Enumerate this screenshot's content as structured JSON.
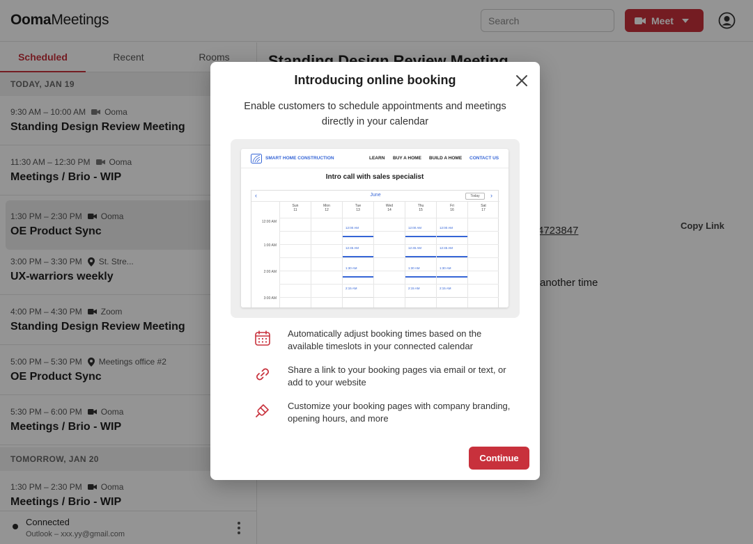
{
  "header": {
    "logo_brand": "Ooma",
    "logo_product": "Meetings",
    "search_placeholder": "Search",
    "meet_label": "Meet"
  },
  "sidebar": {
    "tabs": [
      "Scheduled",
      "Recent",
      "Rooms"
    ],
    "days": [
      {
        "label": "TODAY, JAN 19",
        "events": [
          {
            "time": "9:30 AM – 10:00 AM",
            "icon": "video-icon",
            "location": "Ooma",
            "title": "Standing Design Review Meeting"
          },
          {
            "time": "11:30 AM – 12:30 PM",
            "icon": "video-icon",
            "location": "Ooma",
            "title": "Meetings / Brio - WIP"
          },
          {
            "time": "1:30 PM – 2:30 PM",
            "icon": "video-icon",
            "location": "Ooma",
            "title": "OE Product Sync"
          },
          {
            "time": "3:00 PM – 3:30 PM",
            "icon": "location-pin-icon",
            "location": "St. Stre...",
            "title": "UX-warriors weekly"
          },
          {
            "time": "4:00 PM – 4:30 PM",
            "icon": "video-icon",
            "location": "Zoom",
            "title": "Standing Design Review Meeting"
          },
          {
            "time": "5:00 PM – 5:30 PM",
            "icon": "location-pin-icon",
            "location": "Meetings office #2",
            "title": "OE Product Sync"
          },
          {
            "time": "5:30 PM – 6:00 PM",
            "icon": "video-icon",
            "location": "Ooma",
            "title": "Meetings / Brio - WIP"
          }
        ]
      },
      {
        "label": "TOMORROW, JAN 20",
        "events": [
          {
            "time": "1:30 PM – 2:30 PM",
            "icon": "video-icon",
            "location": "Ooma",
            "title": "Meetings / Brio - WIP"
          }
        ]
      }
    ],
    "footer": {
      "status": "Connected",
      "account": "Outlook – xxx.yy@gmail.com"
    }
  },
  "main": {
    "title": "Standing Design Review Meeting",
    "link_fragment": "4723847",
    "copy_link": "Copy Link",
    "another_time": "another time"
  },
  "modal": {
    "title": "Introducing online booking",
    "subtitle": "Enable customers to schedule appointments and meetings directly in your calendar",
    "preview": {
      "brand": "SMART HOME CONSTRUCTION",
      "nav": [
        "LEARN",
        "BUY A HOME",
        "BUILD A HOME",
        "CONTACT US"
      ],
      "heading": "Intro call with sales specialist",
      "month": "June",
      "today": "Today",
      "days": [
        {
          "name": "Sun",
          "num": "11"
        },
        {
          "name": "Mon",
          "num": "12"
        },
        {
          "name": "Tue",
          "num": "13"
        },
        {
          "name": "Wed",
          "num": "14"
        },
        {
          "name": "Thu",
          "num": "15"
        },
        {
          "name": "Fri",
          "num": "16"
        },
        {
          "name": "Sat",
          "num": "17"
        }
      ],
      "times": [
        "12:00 AM",
        "1:00 AM",
        "2:00 AM",
        "3:00 AM"
      ],
      "slots": [
        "12:00 AM",
        "12:45 AM",
        "1:30 AM",
        "2:15 AM"
      ]
    },
    "features": [
      {
        "icon": "calendar-icon",
        "text": "Automatically adjust booking times based on the available timeslots in your connected calendar"
      },
      {
        "icon": "link-icon",
        "text": "Share a link to your booking pages via email or text, or add to your website"
      },
      {
        "icon": "paintbrush-icon",
        "text": "Customize your booking pages with company branding, opening hours, and more"
      }
    ],
    "continue_label": "Continue"
  },
  "colors": {
    "accent": "#c8313c",
    "preview_accent": "#3565d6"
  }
}
